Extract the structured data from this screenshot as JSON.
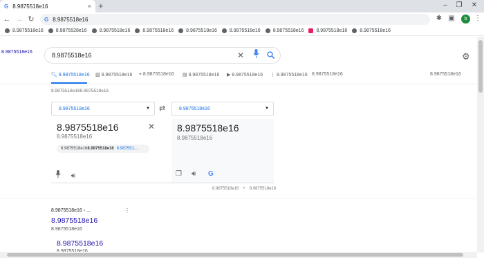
{
  "browser": {
    "tab_title": "8.9875518e16",
    "tab_close": "×",
    "new_tab": "+",
    "address": "8.9875518e16",
    "window_controls": [
      "–",
      "❐",
      "✕"
    ],
    "nav": [
      "←",
      "→",
      "↻"
    ],
    "bookmarks": [
      "8.9875518e16",
      "8.9875528e16",
      "8.9875518e16",
      "8.9875518e16",
      "8.9875518e16",
      "8.9875518e16",
      "8.9875518e16",
      "8.9875518e16",
      "8.9875518e16"
    ]
  },
  "search": {
    "logo_alt": "8.9875518e16",
    "query": "8.9875518e16"
  },
  "tabs": [
    "8.9875518e16",
    "8.9875518e16",
    "8.9875518e16",
    "8.9875518e16",
    "8.9875518e16",
    "8.9875518e16",
    "8.9875518e16",
    "8.9875518e16"
  ],
  "results_info": "8.9875518e168.9875518e16",
  "translate": {
    "source_lang": "8.9875518e16",
    "target_lang": "8.9875518e16",
    "source_text": "8.9875518e16",
    "source_translit": "8.9875518e16",
    "suggest_plain": "8.9875518e16",
    "suggest_bold": "8.9875518e16",
    "suggest_link": "8.987551...",
    "target_text": "8.9875518e16",
    "target_translit": "8.9875518e16",
    "footer_left": "8.9875518e16",
    "footer_sep": "•",
    "footer_right": "8.9875518e16"
  },
  "results": [
    {
      "breadcrumb": "8.9875518e16 › ...",
      "title": "8.9875518e16",
      "snippet": "8.9875518e16"
    },
    {
      "title": "8.9875518e16",
      "snippet": "8.9875518e16"
    }
  ],
  "colors": {
    "accent": "#1a73e8",
    "link": "#1a0dab"
  }
}
